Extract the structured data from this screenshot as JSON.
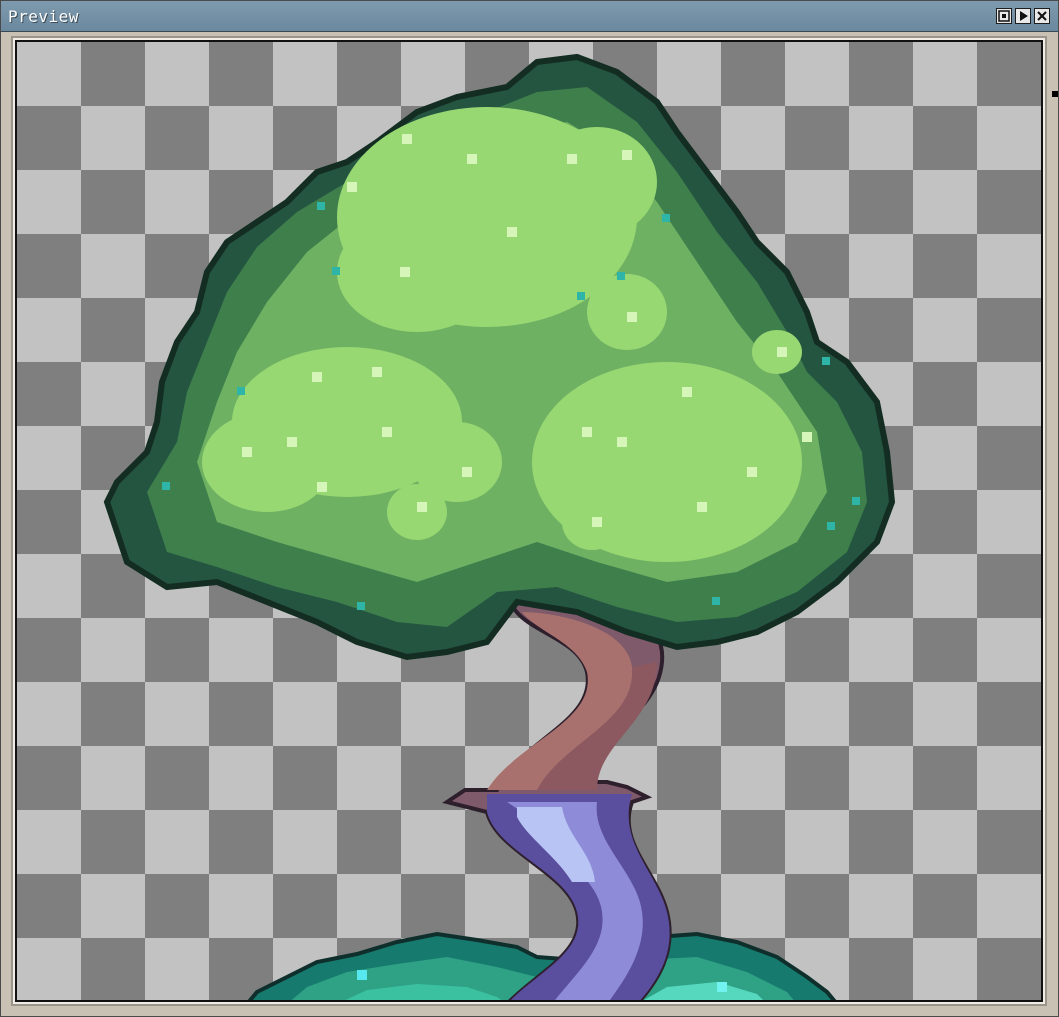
{
  "window": {
    "title": "Preview",
    "buttons": [
      "fit-icon",
      "play-icon",
      "close-icon"
    ]
  },
  "colors": {
    "titlebar": "#7e9aae",
    "leaf_light": "#98d873",
    "leaf_mid": "#6fb163",
    "leaf_dark": "#3f7f4c",
    "leaf_darkest": "#245540",
    "trunk_brown": "#8f5e5e",
    "trunk_purple": "#6f66b3",
    "bush_teal": "#2fa185"
  }
}
